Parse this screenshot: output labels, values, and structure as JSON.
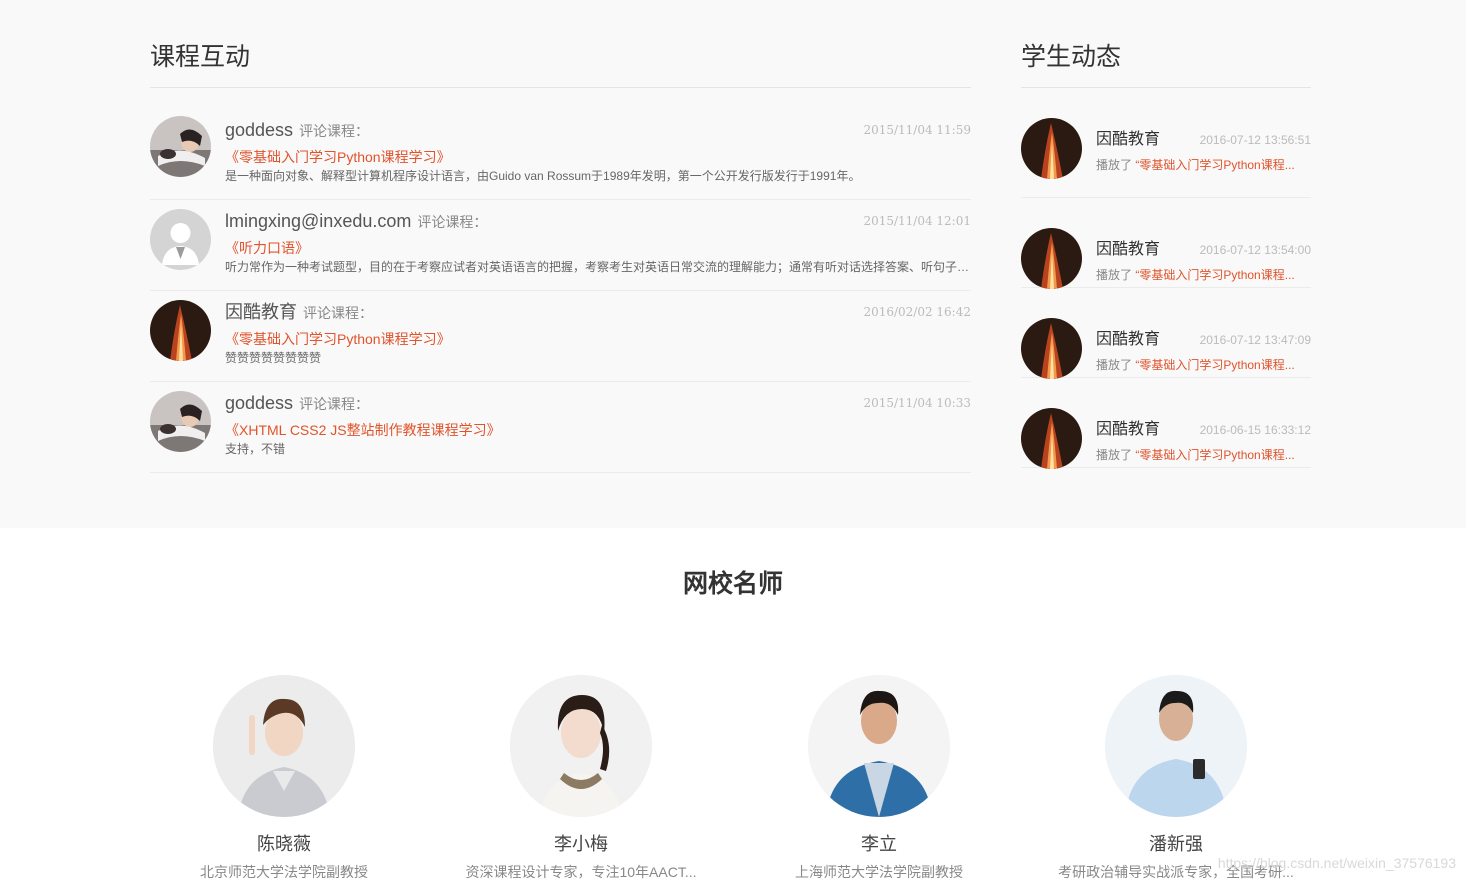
{
  "interaction": {
    "title": "课程互动",
    "verb_label": "评论课程：",
    "items": [
      {
        "user": "goddess",
        "time": "2015/11/04 11:59",
        "course": "《零基础入门学习Python课程学习》",
        "text": "是一种面向对象、解释型计算机程序设计语言，由Guido van Rossum于1989年发明，第一个公开发行版发行于1991年。",
        "avatar": "reclining-woman-avatar"
      },
      {
        "user": "lmingxing@inxedu.com",
        "time": "2015/11/04 12:01",
        "course": "《听力口语》",
        "text": "听力常作为一种考试题型，目的在于考察应试者对英语语言的把握，考察考生对英语日常交流的理解能力；通常有听对话选择答案、听句子选择答案等",
        "avatar": "default-user-avatar"
      },
      {
        "user": "因酷教育",
        "time": "2016/02/02 16:42",
        "course": "《零基础入门学习Python课程学习》",
        "text": "赞赞赞赞赞赞赞赞",
        "avatar": "flame-avatar"
      },
      {
        "user": "goddess",
        "time": "2015/11/04 10:33",
        "course": "《XHTML CSS2 JS整站制作教程课程学习》",
        "text": "支持，不错",
        "avatar": "reclining-woman-avatar"
      }
    ]
  },
  "activity": {
    "title": "学生动态",
    "played_label": "播放了",
    "items": [
      {
        "user": "因酷教育",
        "time": "2016-07-12 13:56:51",
        "course": "“零基础入门学习Python课程..."
      },
      {
        "user": "因酷教育",
        "time": "2016-07-12 13:54:00",
        "course": "“零基础入门学习Python课程..."
      },
      {
        "user": "因酷教育",
        "time": "2016-07-12 13:47:09",
        "course": "“零基础入门学习Python课程..."
      },
      {
        "user": "因酷教育",
        "time": "2016-06-15 16:33:12",
        "course": "“零基础入门学习Python课程..."
      }
    ]
  },
  "teachers": {
    "title": "网校名师",
    "items": [
      {
        "name": "陈晓薇",
        "desc": "北京师范大学法学院副教授"
      },
      {
        "name": "李小梅",
        "desc": "资深课程设计专家，专注10年AACT..."
      },
      {
        "name": "李立",
        "desc": "上海师范大学法学院副教授"
      },
      {
        "name": "潘新强",
        "desc": "考研政治辅导实战派专家，全国考研..."
      }
    ]
  },
  "watermark": "https://blog.csdn.net/weixin_37576193",
  "colors": {
    "accent": "#e0532c",
    "band": "#f9f9f9"
  }
}
